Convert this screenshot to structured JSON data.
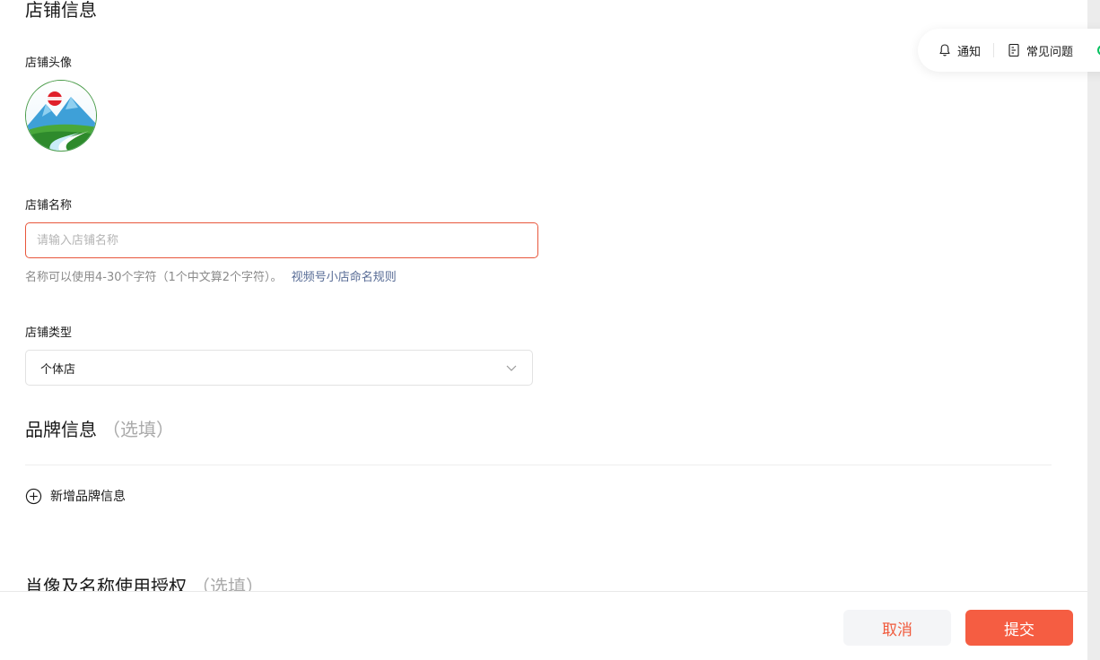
{
  "store_info": {
    "title": "店铺信息",
    "avatar_label": "店铺头像",
    "name_label": "店铺名称",
    "name_value": "",
    "name_placeholder": "请输入店铺名称",
    "name_hint": "名称可以使用4-30个字符（1个中文算2个字符）。",
    "name_rule_link": "视频号小店命名规则",
    "type_label": "店铺类型",
    "type_selected": "个体店"
  },
  "brand_info": {
    "title": "品牌信息",
    "optional": "（选填）",
    "add_label": "新增品牌信息"
  },
  "portrait_auth": {
    "title": "肖像及名称使用授权",
    "optional": "（选填）"
  },
  "float_bar": {
    "notify_label": "通知",
    "faq_label": "常见问题"
  },
  "footer": {
    "cancel_label": "取消",
    "submit_label": "提交"
  },
  "colors": {
    "accent": "#f55d42",
    "error_border": "#e8573c",
    "link": "#576b95"
  }
}
